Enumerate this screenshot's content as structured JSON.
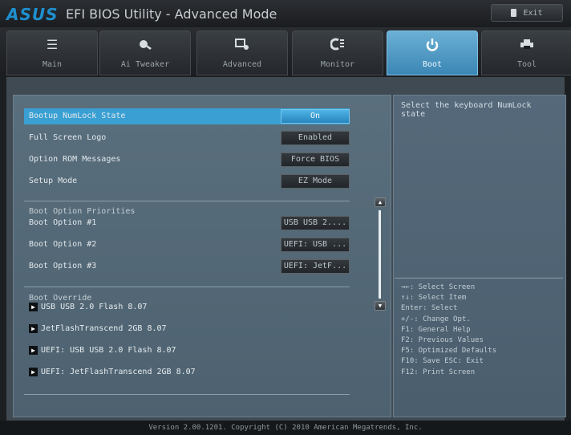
{
  "header": {
    "brand": "ASUS",
    "title": "EFI BIOS Utility - Advanced Mode",
    "exit_label": "Exit"
  },
  "tabs": [
    {
      "label": "Main",
      "icon": "list-icon"
    },
    {
      "label": "Ai Tweaker",
      "icon": "tweaker-icon"
    },
    {
      "label": "Advanced",
      "icon": "advanced-icon"
    },
    {
      "label": "Monitor",
      "icon": "monitor-icon"
    },
    {
      "label": "Boot",
      "icon": "power-icon",
      "active": true
    },
    {
      "label": "Tool",
      "icon": "printer-icon"
    }
  ],
  "settings": {
    "numlock": {
      "label": "Bootup NumLock State",
      "value": "On"
    },
    "fullscreen_logo": {
      "label": "Full Screen Logo",
      "value": "Enabled"
    },
    "option_rom": {
      "label": "Option ROM Messages",
      "value": "Force BIOS"
    },
    "setup_mode": {
      "label": "Setup Mode",
      "value": "EZ Mode"
    }
  },
  "boot_priorities": {
    "title": "Boot Option Priorities",
    "options": [
      {
        "label": "Boot Option #1",
        "value": "USB USB 2...."
      },
      {
        "label": "Boot Option #2",
        "value": "UEFI: USB ..."
      },
      {
        "label": "Boot Option #3",
        "value": "UEFI: JetF..."
      }
    ]
  },
  "boot_override": {
    "title": "Boot Override",
    "items": [
      "USB USB 2.0 Flash 8.07",
      "JetFlashTranscend 2GB 8.07",
      "UEFI: USB USB 2.0 Flash 8.07",
      "UEFI: JetFlashTranscend 2GB 8.07"
    ]
  },
  "help": {
    "description": "Select the keyboard NumLock state",
    "keys": [
      "→←: Select Screen",
      "↑↓: Select Item",
      "Enter: Select",
      "+/-: Change Opt.",
      "F1: General Help",
      "F2: Previous Values",
      "F5: Optimized Defaults",
      "F10: Save  ESC: Exit",
      "F12: Print Screen"
    ]
  },
  "footer": {
    "text": "Version 2.00.1201. Copyright (C) 2010 American Megatrends, Inc."
  },
  "colors": {
    "accent": "#3aa0d3",
    "brand": "#1e8fcf",
    "active_tab": "#4a97c4"
  }
}
